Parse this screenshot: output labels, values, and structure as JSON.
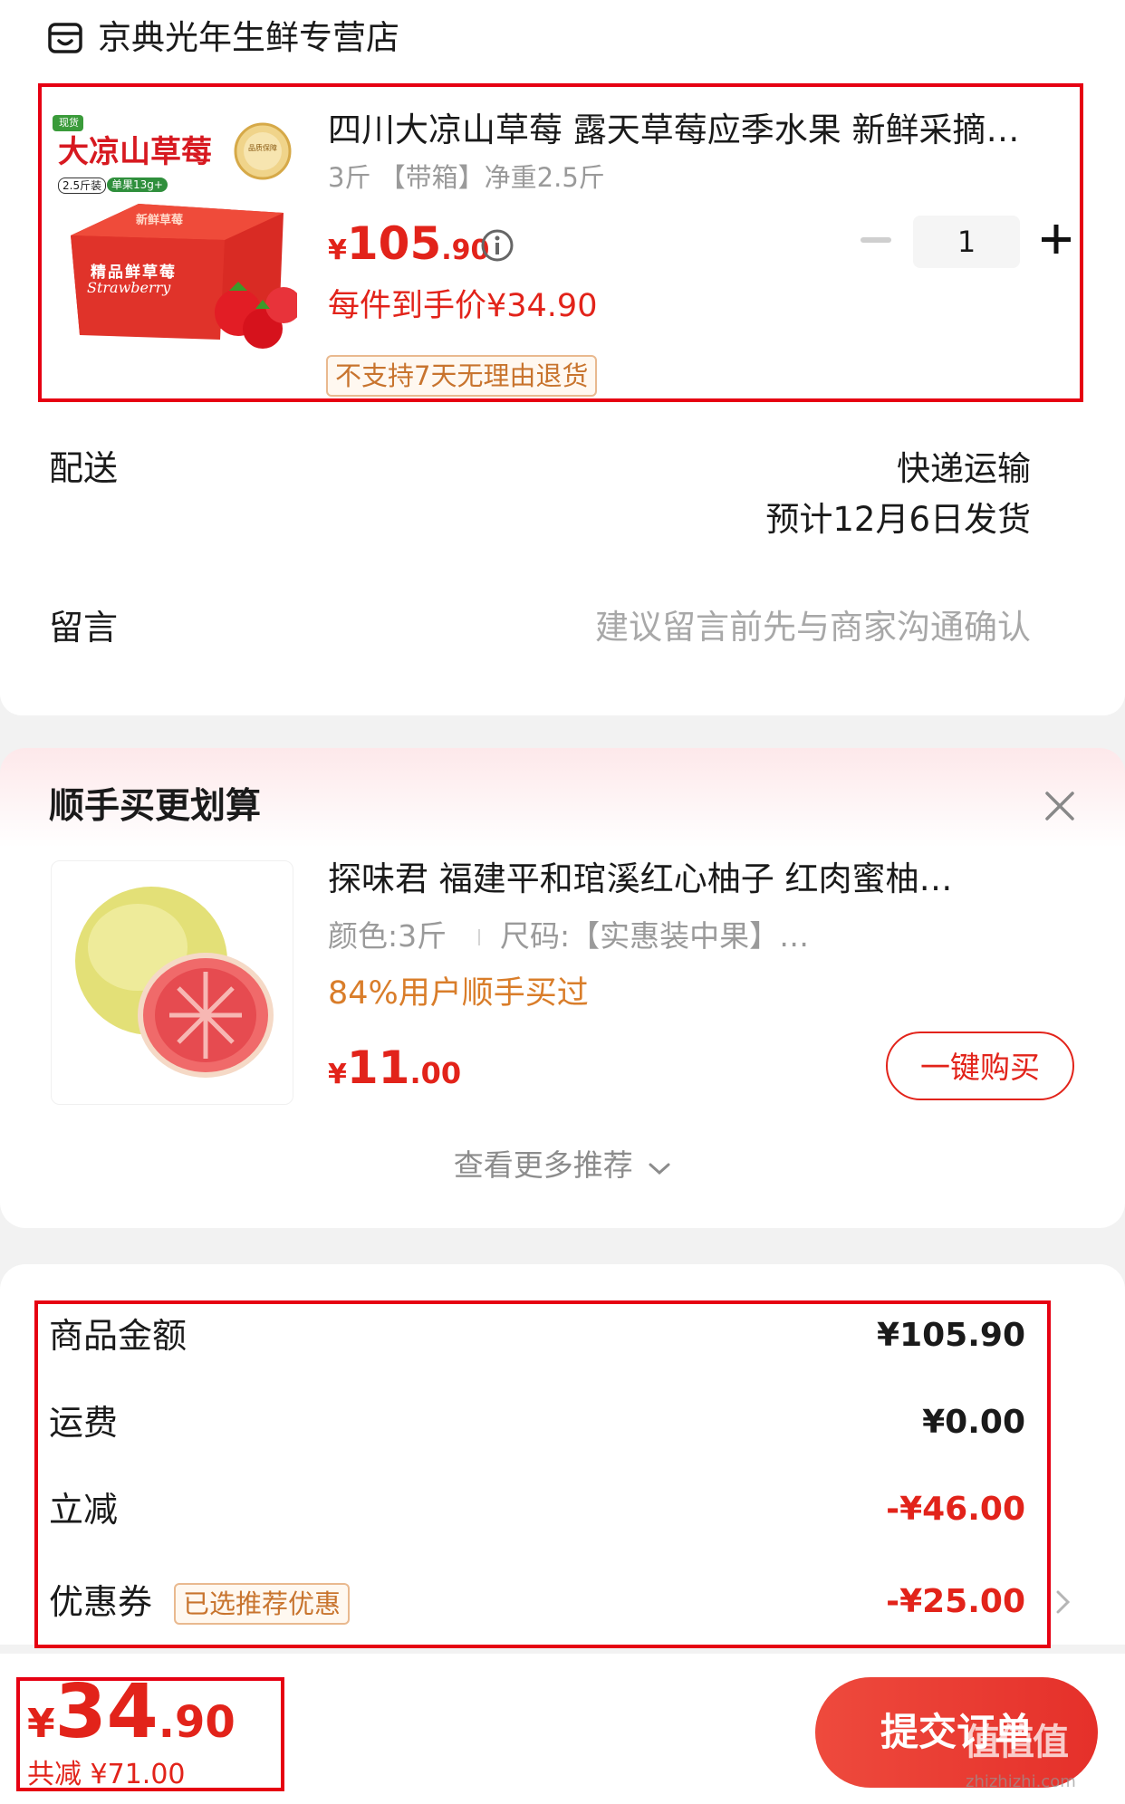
{
  "store": {
    "name": "京典光年生鲜专营店",
    "icon": "store-icon"
  },
  "product": {
    "title": "四川大凉山草莓 露天草莓应季水果 新鲜采摘…",
    "spec": "3斤 【带箱】净重2.5斤",
    "price_symbol": "¥",
    "price_int": "105",
    "price_dec": ".90",
    "unit_price": "每件到手价¥34.90",
    "return_tag": "不支持7天无理由退货",
    "quantity": "1",
    "image_text": {
      "badge": "现货",
      "name": "大凉山草莓",
      "weight": "2.5斤装",
      "size": "单果13g+",
      "box_label": "精品鲜草莓",
      "box_script": "Strawberry",
      "box_top": "新鲜草莓",
      "seal": "品质保障"
    }
  },
  "delivery": {
    "label": "配送",
    "method": "快递运输",
    "eta": "预计12月6日发货"
  },
  "message": {
    "label": "留言",
    "placeholder": "建议留言前先与商家沟通确认"
  },
  "recommend": {
    "section_title": "顺手买更划算",
    "title": "探味君 福建平和琯溪红心柚子 红肉蜜柚…",
    "spec_color": "颜色:3斤",
    "spec_size": "尺码:【实惠装中果】…",
    "social_proof": "84%用户顺手买过",
    "price_symbol": "¥",
    "price_int": "11",
    "price_dec": ".00",
    "buy_button": "一键购买",
    "more_link": "查看更多推荐"
  },
  "summary": {
    "rows": [
      {
        "label": "商品金额",
        "value": "¥105.90"
      },
      {
        "label": "运费",
        "value": "¥0.00"
      },
      {
        "label": "立减",
        "value": "-¥46.00"
      },
      {
        "label": "优惠券",
        "value": "-¥25.00",
        "tag": "已选推荐优惠"
      }
    ]
  },
  "footer": {
    "total_symbol": "¥",
    "total_int": "34",
    "total_dec": ".90",
    "saved": "共减 ¥71.00",
    "submit": "提交订单"
  },
  "watermark": {
    "name": "值值值",
    "url": "zhizhizhi.com"
  },
  "colors": {
    "accent": "#e2231a",
    "annotation": "#e60012",
    "tag_border": "#e9b98f"
  }
}
